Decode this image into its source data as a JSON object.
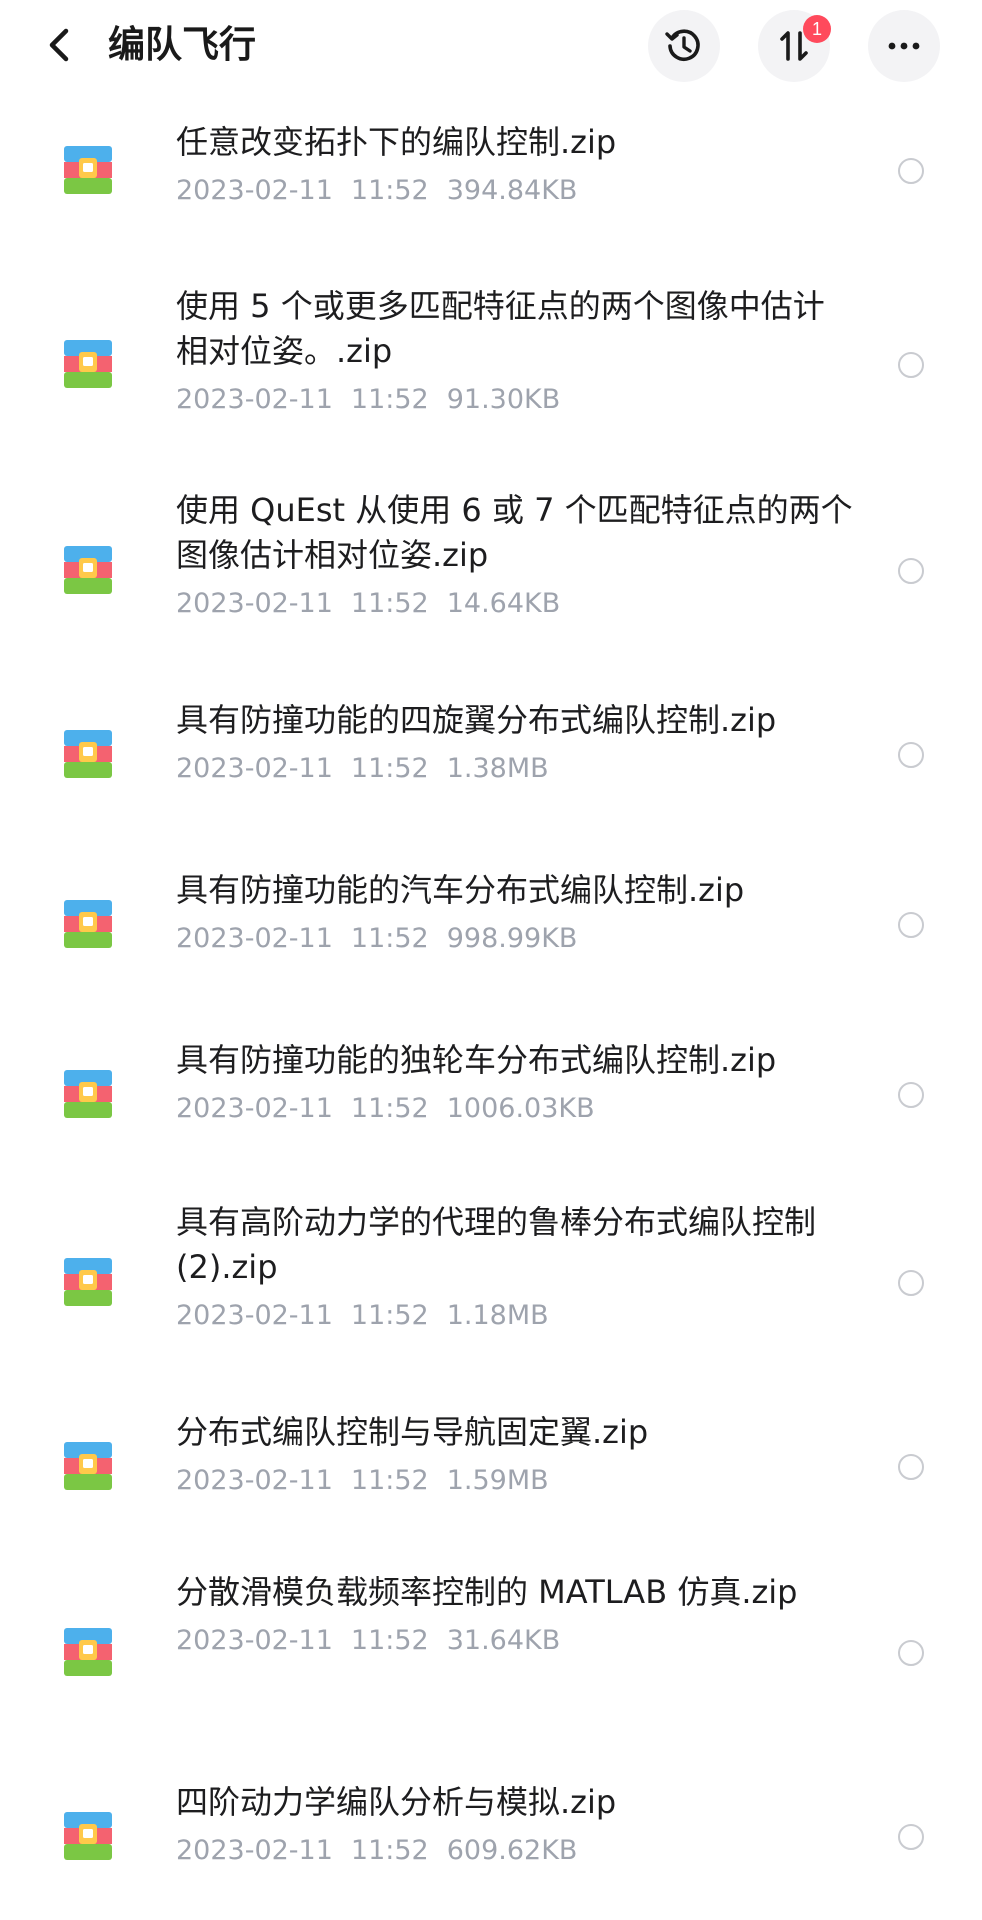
{
  "header": {
    "title": "编队飞行",
    "back_icon": "chevron-left-icon",
    "history_icon": "history-icon",
    "transfer_icon": "transfer-icon",
    "transfer_badge": "1",
    "more_icon": "more-icon"
  },
  "colors": {
    "badge": "#ff4a5c",
    "meta_text": "#9ea3ad",
    "title_text": "#1a1a1a",
    "button_bg": "#f3f3f5"
  },
  "files": [
    {
      "name": "任意改变拓扑下的编队控制.zip",
      "date": "2023-02-11",
      "time": "11:52",
      "size": "394.84KB"
    },
    {
      "name": "使用 5 个或更多匹配特征点的两个图像中估计相对位姿。.zip",
      "date": "2023-02-11",
      "time": "11:52",
      "size": "91.30KB"
    },
    {
      "name": "使用 QuEst 从使用 6 或 7 个匹配特征点的两个图像估计相对位姿.zip",
      "date": "2023-02-11",
      "time": "11:52",
      "size": "14.64KB"
    },
    {
      "name": "具有防撞功能的四旋翼分布式编队控制.zip",
      "date": "2023-02-11",
      "time": "11:52",
      "size": "1.38MB"
    },
    {
      "name": "具有防撞功能的汽车分布式编队控制.zip",
      "date": "2023-02-11",
      "time": "11:52",
      "size": "998.99KB"
    },
    {
      "name": "具有防撞功能的独轮车分布式编队控制.zip",
      "date": "2023-02-11",
      "time": "11:52",
      "size": "1006.03KB"
    },
    {
      "name": "具有高阶动力学的代理的鲁棒分布式编队控制 (2).zip",
      "date": "2023-02-11",
      "time": "11:52",
      "size": "1.18MB"
    },
    {
      "name": "分布式编队控制与导航固定翼.zip",
      "date": "2023-02-11",
      "time": "11:52",
      "size": "1.59MB"
    },
    {
      "name": "分散滑模负载频率控制的 MATLAB 仿真.zip",
      "date": "2023-02-11",
      "time": "11:52",
      "size": "31.64KB"
    },
    {
      "name": "四阶动力学编队分析与模拟.zip",
      "date": "2023-02-11",
      "time": "11:52",
      "size": "609.62KB"
    }
  ]
}
